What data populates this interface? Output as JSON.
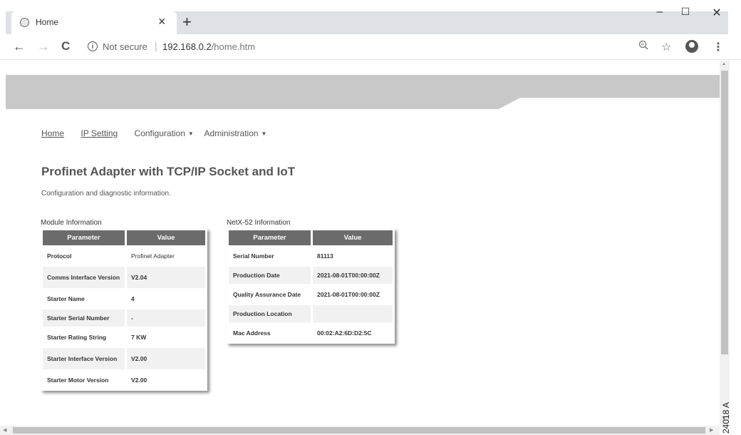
{
  "browser": {
    "tab_title": "Home",
    "tab_close": "×",
    "new_tab": "+",
    "window_controls": {
      "minimize": "–",
      "maximize": "☐",
      "close": "✕"
    },
    "nav": {
      "back": "←",
      "forward": "→",
      "reload": "C"
    },
    "security_label": "Not secure",
    "url_host": "192.168.0.2",
    "url_path": "/home.htm",
    "icons": [
      "zoom-icon",
      "star-icon",
      "profile-icon",
      "menu-dots-icon"
    ]
  },
  "menu": {
    "home": "Home",
    "ip_setting": "IP Setting",
    "configuration": "Configuration",
    "administration": "Administration",
    "caret": "▼"
  },
  "page": {
    "title": "Profinet Adapter with TCP/IP Socket and IoT",
    "subtitle": "Configuration and diagnostic information."
  },
  "module_info": {
    "title": "Module Information",
    "headers": [
      "Parameter",
      "Value"
    ],
    "rows": [
      [
        "Protocol",
        "Profinet Adapter"
      ],
      [
        "Comms Interface Version",
        "V2.04"
      ],
      [
        "Starter Name",
        "4"
      ],
      [
        "Starter Serial Number",
        "-"
      ],
      [
        "Starter Rating String",
        "7 KW"
      ],
      [
        "Starter Interface Version",
        "V2.00"
      ],
      [
        "Starter Motor Version",
        "V2.00"
      ]
    ]
  },
  "netx_info": {
    "title": "NetX-52 Information",
    "headers": [
      "Parameter",
      "Value"
    ],
    "rows": [
      [
        "Serial Number",
        "81113"
      ],
      [
        "Production Date",
        "2021-08-01T00:00:00Z"
      ],
      [
        "Quality Assurance Date",
        "2021-08-01T00:00:00Z"
      ],
      [
        "Production Location",
        ""
      ],
      [
        "Mac Address",
        "00:02:A2:6D:D2:5C"
      ]
    ]
  },
  "doc_ref": "24018 A"
}
